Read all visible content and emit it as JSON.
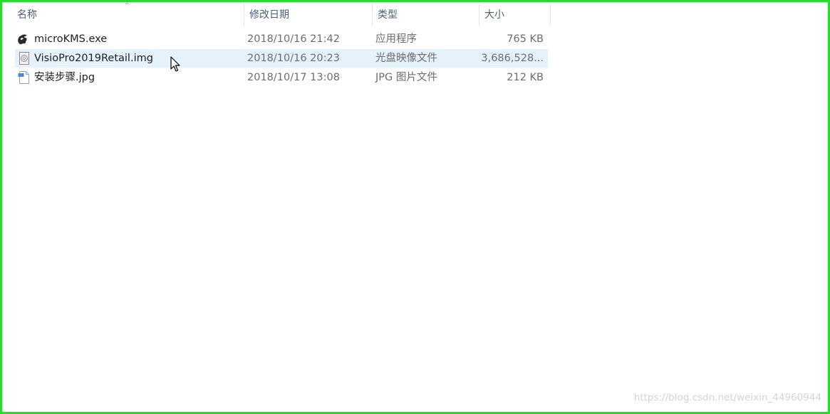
{
  "columns": {
    "name": "名称",
    "date": "修改日期",
    "type": "类型",
    "size": "大小"
  },
  "files": [
    {
      "name": "microKMS.exe",
      "date": "2018/10/16 21:42",
      "type": "应用程序",
      "size": "765 KB",
      "icon": "executable-icon",
      "selected": false
    },
    {
      "name": "VisioPro2019Retail.img",
      "date": "2018/10/16 20:23",
      "type": "光盘映像文件",
      "size": "3,686,528...",
      "icon": "disc-image-icon",
      "selected": true
    },
    {
      "name": "安装步骤.jpg",
      "date": "2018/10/17 13:08",
      "type": "JPG 图片文件",
      "size": "212 KB",
      "icon": "image-file-icon",
      "selected": false
    }
  ],
  "watermark": "https://blog.csdn.net/weixin_44960944",
  "colors": {
    "frame_border": "#22e02a",
    "selected_row": "#e5f1fb",
    "header_text": "#4c607a",
    "meta_text": "#6d6d6d"
  }
}
